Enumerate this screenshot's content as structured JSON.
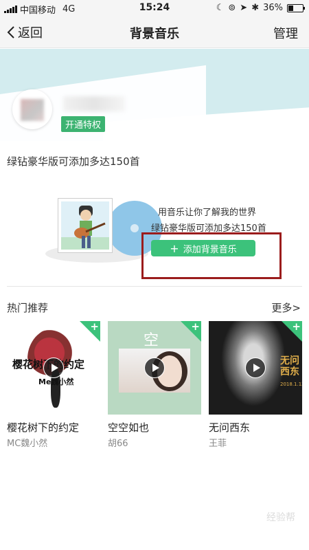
{
  "status_bar": {
    "carrier": "中国移动",
    "network": "4G",
    "time": "15:24",
    "battery": "36%",
    "battery_level": 0.36
  },
  "nav": {
    "back_label": "返回",
    "title": "背景音乐",
    "manage_label": "管理"
  },
  "profile": {
    "vip_badge": "开通特权"
  },
  "info_text": "绿钻豪华版可添加多达150首",
  "empty_state": {
    "line1": "用音乐让你了解我的世界",
    "line2": "绿钻豪华版可添加多达150首",
    "add_button": "添加背景音乐",
    "add_icon": "+"
  },
  "recommend": {
    "title": "热门推荐",
    "more": "更多>",
    "items": [
      {
        "song": "樱花树下的约定",
        "artist": "MC魏小然",
        "cover_text1": "樱花树下的约定",
        "cover_text2": "Me魏小然"
      },
      {
        "song": "空空如也",
        "artist": "胡66",
        "cover_char": "空"
      },
      {
        "song": "无问西东",
        "artist": "王菲",
        "cover_title": "无问西东",
        "cover_date": "2018.1.12"
      }
    ]
  },
  "watermark": "经验帮"
}
